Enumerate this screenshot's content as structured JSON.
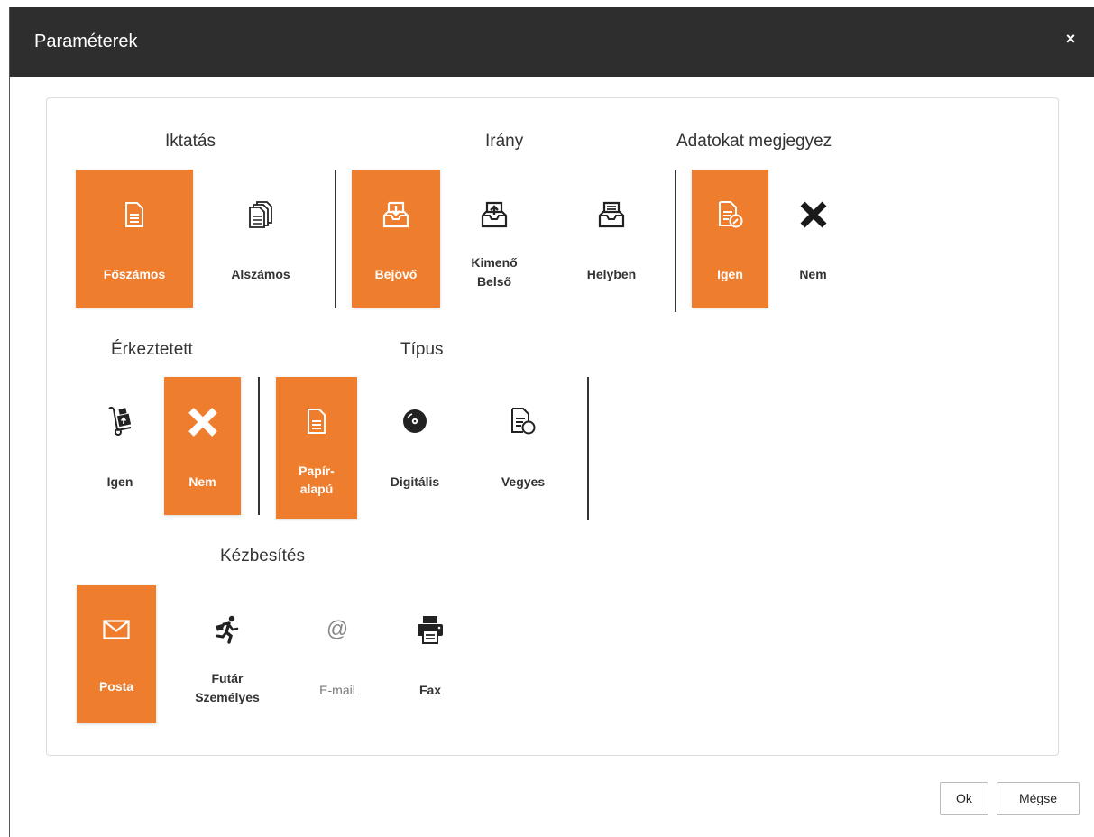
{
  "dialog": {
    "title": "Paraméterek",
    "close_glyph": "×"
  },
  "accent_color": "#ee7d2d",
  "groups": {
    "iktatas": {
      "title": "Iktatás",
      "options": [
        {
          "label": "Főszámos",
          "icon": "document-icon",
          "selected": true
        },
        {
          "label": "Alszámos",
          "icon": "documents-stack-icon",
          "selected": false
        }
      ]
    },
    "irany": {
      "title": "Irány",
      "options": [
        {
          "label": "Bejövő",
          "icon": "inbox-in-icon",
          "selected": true
        },
        {
          "label_line1": "Kimenő",
          "label_line2": "Belső",
          "icon": "inbox-out-icon",
          "selected": false
        },
        {
          "label": "Helyben",
          "icon": "inbox-doc-icon",
          "selected": false
        }
      ]
    },
    "adatok": {
      "title": "Adatokat megjegyez",
      "options": [
        {
          "label": "Igen",
          "icon": "document-edit-icon",
          "selected": true
        },
        {
          "label": "Nem",
          "icon": "x-icon",
          "selected": false
        }
      ]
    },
    "erkeztetett": {
      "title": "Érkeztetett",
      "options": [
        {
          "label": "Igen",
          "icon": "hand-truck-icon",
          "selected": false
        },
        {
          "label": "Nem",
          "icon": "x-icon",
          "selected": true
        }
      ]
    },
    "tipus": {
      "title": "Típus",
      "options": [
        {
          "label_line1": "Papír-",
          "label_line2": "alapú",
          "icon": "document-icon",
          "selected": true
        },
        {
          "label": "Digitális",
          "icon": "disc-icon",
          "selected": false
        },
        {
          "label": "Vegyes",
          "icon": "document-disc-icon",
          "selected": false
        }
      ]
    },
    "kezbesites": {
      "title": "Kézbesítés",
      "options": [
        {
          "label": "Posta",
          "icon": "envelope-icon",
          "selected": true
        },
        {
          "label_line1": "Futár",
          "label_line2": "Személyes",
          "icon": "runner-icon",
          "selected": false
        },
        {
          "label": "E-mail",
          "icon": "at-icon",
          "selected": false,
          "disabled": true
        },
        {
          "label": "Fax",
          "icon": "printer-icon",
          "selected": false
        }
      ]
    }
  },
  "footer": {
    "ok_label": "Ok",
    "cancel_label": "Mégse"
  }
}
